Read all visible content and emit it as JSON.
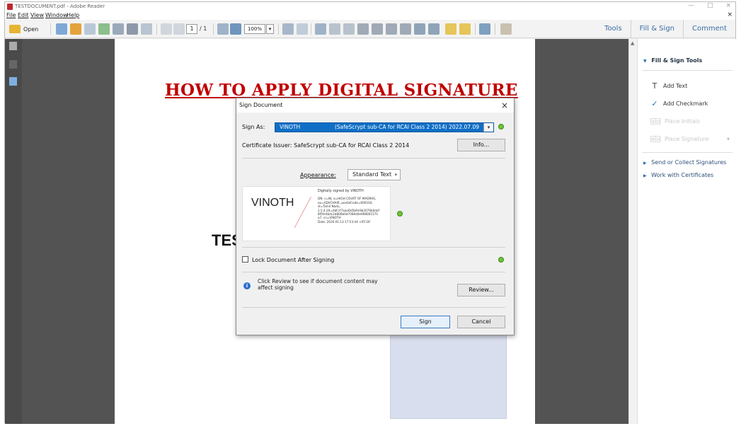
{
  "window": {
    "title": "TESTDOCUMENT.pdf - Adobe Reader",
    "controls": [
      "—",
      "□",
      "×"
    ]
  },
  "menu": {
    "items": [
      "File",
      "Edit",
      "View",
      "Window",
      "Help"
    ],
    "close_doc": "×"
  },
  "toolbar": {
    "open_label": "Open",
    "current_page": "1",
    "total_pages": "/ 1",
    "zoom": "100%",
    "zoom_dropdown": "▾",
    "right_tabs": [
      "Tools",
      "Fill & Sign",
      "Comment"
    ]
  },
  "document": {
    "heading": "HOW TO APPLY DIGITAL SIGNATURE",
    "body_text": "TES"
  },
  "right_pane": {
    "section_title": "Fill & Sign Tools",
    "items": [
      {
        "icon": "T",
        "label": "Add Text",
        "enabled": true
      },
      {
        "icon": "✓",
        "label": "Add Checkmark",
        "enabled": true
      },
      {
        "icon": "abc",
        "label": "Place Initials",
        "enabled": false
      },
      {
        "icon": "abc",
        "label": "Place Signature",
        "enabled": false
      }
    ],
    "more_icon": "▾",
    "collapsed_sections": [
      "Send or Collect Signatures",
      "Work with Certificates"
    ],
    "section_marker": "▼",
    "collapsed_marker": "▶"
  },
  "dialog": {
    "title": "Sign Document",
    "close": "×",
    "sign_as_label": "Sign As:",
    "sign_as_name": "VINOTH",
    "sign_as_issuer": "(SafeScrypt sub-CA for RCAI Class 2 2014) 2022.07.09",
    "dropdown": "▾",
    "cert_issuer_label": "Certificate Issuer: SafeScrypt sub-CA for RCAI Class 2 2014",
    "info_button": "Info...",
    "appearance_label": "Appearance:",
    "appearance_value": "Standard Text",
    "preview": {
      "name": "VINOTH",
      "header": "Digitally signed by VINOTH",
      "lines": [
        "DN: c=IN, o=HIGH COURT OF MADRAS,",
        "ou=ADVCHAIR, postalCode=600104,",
        "st=Tamil Nadu,",
        "2.5.4.20=AdFcf7aaeDd5b9c9b2070b0def",
        "8f5fe4bdc2d806b0d7068d4e698001575",
        "a7, cn=VINOTH",
        "Date: 2020.01.13 17:53:44 +05'30'"
      ]
    },
    "lock_label": "Lock Document After Signing",
    "review_text": "Click Review to see if document content may affect signing",
    "review_button": "Review...",
    "info_icon": "i",
    "sign_button": "Sign",
    "cancel_button": "Cancel"
  },
  "colors": {
    "heading": "#c00000",
    "selection": "#0f6fc6",
    "status_ok": "#6fc23a",
    "workspace": "#535353",
    "signature_field": "#d9deee"
  }
}
